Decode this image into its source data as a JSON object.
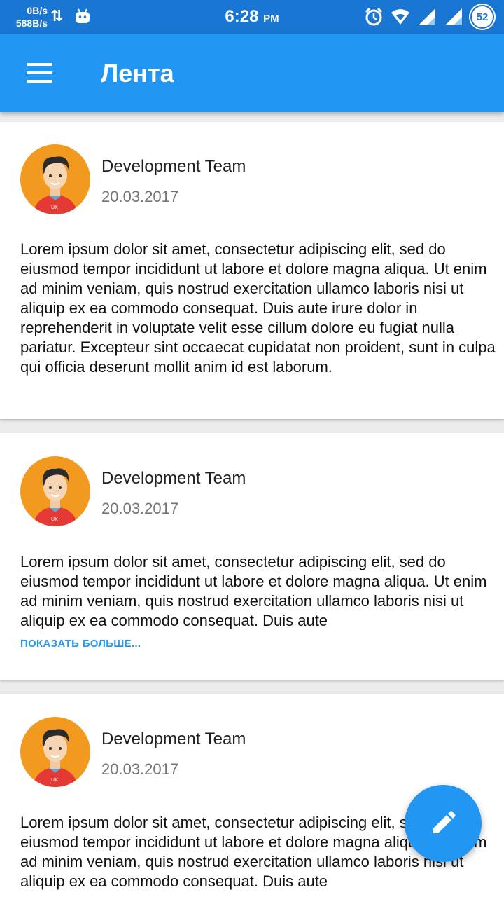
{
  "status_bar": {
    "net_down": "0B/s",
    "net_up": "588B/s",
    "time": "6:28",
    "ampm": "PM",
    "battery": "52"
  },
  "app_bar": {
    "title": "Лента"
  },
  "posts": [
    {
      "author": "Development Team",
      "date": "20.03.2017",
      "text": "Lorem ipsum dolor sit amet, consectetur adipiscing elit, sed do eiusmod tempor incididunt ut labore et dolore magna aliqua. Ut enim ad minim veniam, quis nostrud exercitation ullamco laboris nisi ut aliquip ex ea commodo consequat. Duis aute irure dolor in reprehenderit in voluptate velit esse cillum dolore eu fugiat nulla pariatur. Excepteur sint occaecat cupidatat non proident, sunt in culpa qui officia deserunt mollit anim id est laborum."
    },
    {
      "author": "Development Team",
      "date": "20.03.2017",
      "text": "Lorem ipsum dolor sit amet, consectetur adipiscing elit, sed do eiusmod tempor incididunt ut labore et dolore magna aliqua. Ut enim ad minim veniam, quis nostrud exercitation ullamco laboris nisi ut aliquip ex ea commodo consequat. Duis aute",
      "more_label": "ПОКАЗАТЬ БОЛЬШЕ..."
    },
    {
      "author": "Development Team",
      "date": "20.03.2017",
      "text": "Lorem ipsum dolor sit amet, consectetur adipiscing elit, sed do eiusmod tempor incididunt ut labore et dolore magna aliqua. Ut enim ad minim veniam, quis nostrud exercitation ullamco laboris nisi ut aliquip ex ea commodo consequat. Duis aute"
    }
  ],
  "icons": {
    "menu": "menu-icon",
    "fab": "pencil-icon",
    "avatar": "avatar-illustration"
  },
  "colors": {
    "status_bar": "#1976d2",
    "app_bar": "#2196f3",
    "accent": "#2196f3",
    "avatar_bg": "#f29a20"
  }
}
